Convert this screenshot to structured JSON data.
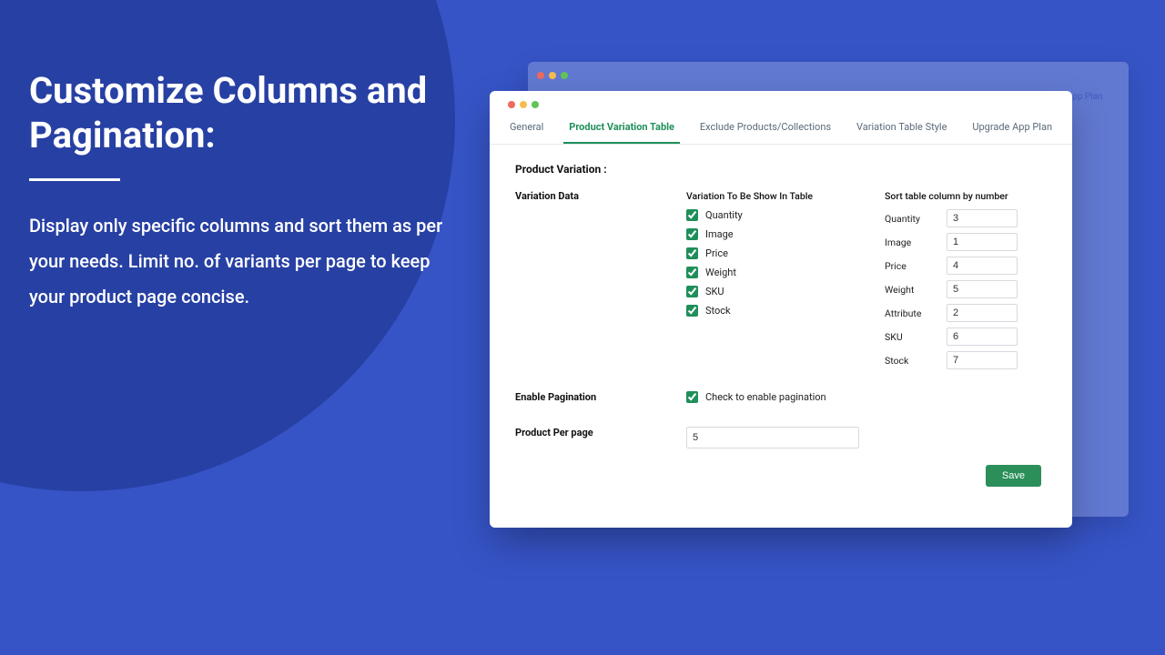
{
  "promo": {
    "title": "Customize Columns and Pagination:",
    "description": "Display only specific columns and sort them as per your needs. Limit no. of variants per page to keep your product page concise."
  },
  "tabs": [
    {
      "label": "General",
      "active": false
    },
    {
      "label": "Product Variation Table",
      "active": true
    },
    {
      "label": "Exclude Products/Collections",
      "active": false
    },
    {
      "label": "Variation Table Style",
      "active": false
    },
    {
      "label": "Upgrade App Plan",
      "active": false
    }
  ],
  "section_title": "Product Variation :",
  "labels": {
    "variation_data": "Variation Data",
    "show_in_table": "Variation To Be Show In Table",
    "sort_by_number": "Sort table column by number",
    "enable_pagination": "Enable Pagination",
    "pagination_check_label": "Check to enable pagination",
    "product_per_page": "Product Per page",
    "save": "Save"
  },
  "show_checks": [
    {
      "label": "Quantity",
      "checked": true
    },
    {
      "label": "Image",
      "checked": true
    },
    {
      "label": "Price",
      "checked": true
    },
    {
      "label": "Weight",
      "checked": true
    },
    {
      "label": "SKU",
      "checked": true
    },
    {
      "label": "Stock",
      "checked": true
    }
  ],
  "sort_fields": [
    {
      "label": "Quantity",
      "value": "3"
    },
    {
      "label": "Image",
      "value": "1"
    },
    {
      "label": "Price",
      "value": "4"
    },
    {
      "label": "Weight",
      "value": "5"
    },
    {
      "label": "Attribute",
      "value": "2"
    },
    {
      "label": "SKU",
      "value": "6"
    },
    {
      "label": "Stock",
      "value": "7"
    }
  ],
  "pagination_enabled": true,
  "product_per_page_value": "5"
}
